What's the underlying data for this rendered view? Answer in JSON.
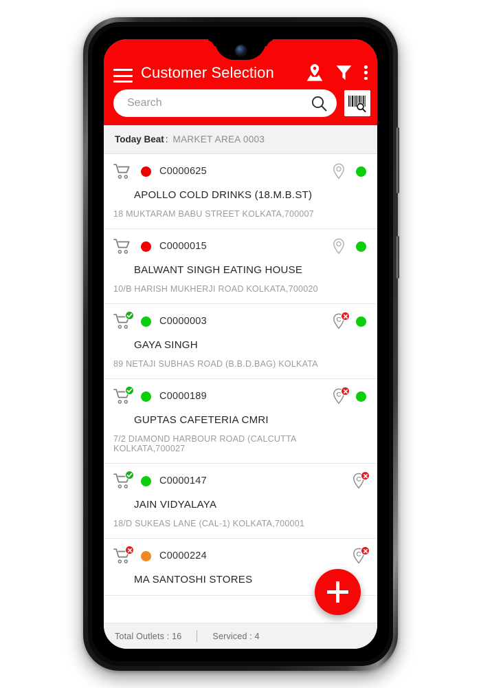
{
  "app": {
    "title": "Customer Selection",
    "accent_color": "#FA0505",
    "menu_icon": "hamburger-icon",
    "map_pin_icon": "map-location-icon",
    "filter_icon": "filter-funnel-icon",
    "overflow_icon": "overflow-menu-icon"
  },
  "search": {
    "placeholder": "Search",
    "value": "",
    "search_icon": "magnifier-icon",
    "barcode_icon": "barcode-scan-icon"
  },
  "beat": {
    "label": "Today Beat",
    "separator": ":",
    "value": "MARKET AREA 0003"
  },
  "colors": {
    "status_red": "#F20000",
    "status_green": "#0ACF0A",
    "status_orange": "#EF8A22",
    "badge_ok": "#12B312",
    "badge_no": "#E02020"
  },
  "customers": [
    {
      "code": "C0000625",
      "name": "APOLLO COLD DRINKS (18.M.B.ST)",
      "address": "18 MUKTARAM BABU STREET KOLKATA,700007",
      "status": "red",
      "cart_badge": "none",
      "pin_badge": "none",
      "right_dot": true
    },
    {
      "code": "C0000015",
      "name": "BALWANT SINGH EATING HOUSE",
      "address": "10/B HARISH MUKHERJI ROAD KOLKATA,700020",
      "status": "red",
      "cart_badge": "none",
      "pin_badge": "none",
      "right_dot": true
    },
    {
      "code": "C0000003",
      "name": "GAYA SINGH",
      "address": "89 NETAJI SUBHAS ROAD (B.B.D.BAG) KOLKATA",
      "status": "green",
      "cart_badge": "ok",
      "pin_badge": "no",
      "right_dot": true
    },
    {
      "code": "C0000189",
      "name": "GUPTAS CAFETERIA CMRI",
      "address": "7/2 DIAMOND HARBOUR ROAD (CALCUTTA KOLKATA,700027",
      "status": "green",
      "cart_badge": "ok",
      "pin_badge": "no",
      "right_dot": true
    },
    {
      "code": "C0000147",
      "name": "JAIN VIDYALAYA",
      "address": "18/D SUKEAS LANE  (CAL-1) KOLKATA,700001",
      "status": "green",
      "cart_badge": "ok",
      "pin_badge": "no",
      "right_dot": false
    },
    {
      "code": "C0000224",
      "name": "MA SANTOSHI STORES",
      "address": "",
      "status": "orange",
      "cart_badge": "no",
      "pin_badge": "no",
      "right_dot": false
    }
  ],
  "footer": {
    "total_outlets": "Total Outlets : 16",
    "serviced": "Serviced : 4"
  },
  "fab": {
    "label": "+",
    "icon": "plus-icon"
  }
}
